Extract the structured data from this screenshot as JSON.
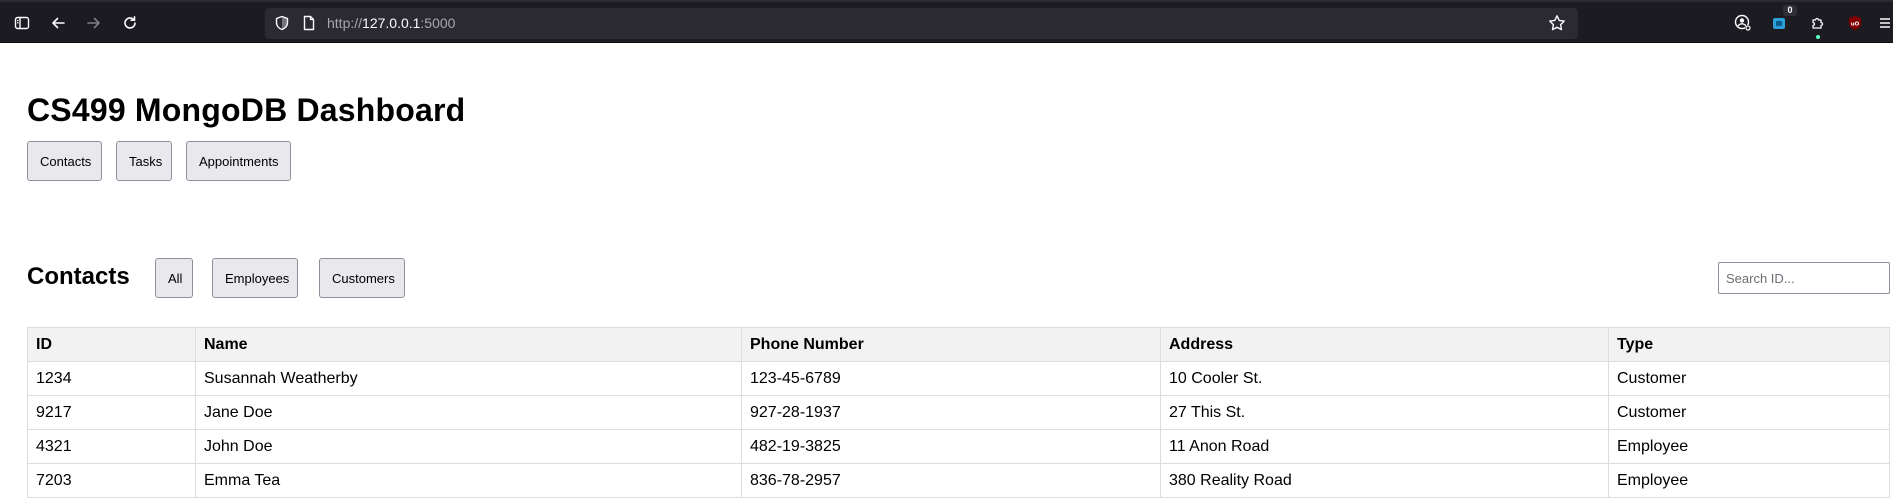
{
  "browser": {
    "url_prefix": "http://",
    "url_host": "127.0.0.1",
    "url_suffix": ":5000",
    "extension_badge": "0"
  },
  "page": {
    "title": "CS499 MongoDB Dashboard",
    "nav_buttons": [
      "Contacts",
      "Tasks",
      "Appointments"
    ]
  },
  "contacts": {
    "heading": "Contacts",
    "filters": [
      "All",
      "Employees",
      "Customers"
    ],
    "search_placeholder": "Search ID...",
    "columns": [
      "ID",
      "Name",
      "Phone Number",
      "Address",
      "Type"
    ],
    "rows": [
      [
        "1234",
        "Susannah Weatherby",
        "123-45-6789",
        "10 Cooler St.",
        "Customer"
      ],
      [
        "9217",
        "Jane Doe",
        "927-28-1937",
        "27 This St.",
        "Customer"
      ],
      [
        "4321",
        "John Doe",
        "482-19-3825",
        "11 Anon Road",
        "Employee"
      ],
      [
        "7203",
        "Emma Tea",
        "836-78-2957",
        "380 Reality Road",
        "Employee"
      ]
    ]
  },
  "icons": {
    "sidebar": "sidebar-icon",
    "back": "back-arrow-icon",
    "forward": "forward-arrow-icon",
    "reload": "reload-icon",
    "shield": "shield-icon",
    "page": "page-icon",
    "bookmark": "star-icon",
    "account": "account-icon",
    "extension": "extension-icon",
    "extensions_menu": "puzzle-icon",
    "ublock": "ublock-icon",
    "menu": "hamburger-menu-icon"
  }
}
